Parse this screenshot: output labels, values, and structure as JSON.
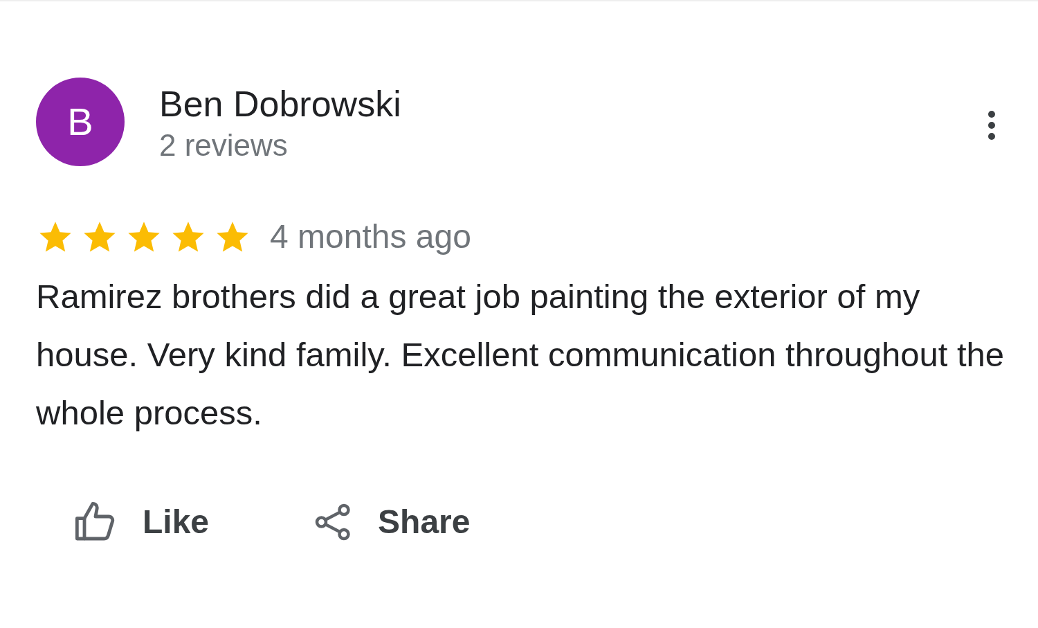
{
  "review": {
    "avatar_letter": "B",
    "name": "Ben Dobrowski",
    "reviews_count": "2 reviews",
    "stars": 5,
    "time": "4 months ago",
    "text": "Ramirez brothers did a great job painting the exterior of my house. Very kind family. Excellent communication throughout the whole process.",
    "actions": [
      {
        "kind": "like",
        "label": "Like"
      },
      {
        "kind": "share",
        "label": "Share"
      }
    ]
  }
}
